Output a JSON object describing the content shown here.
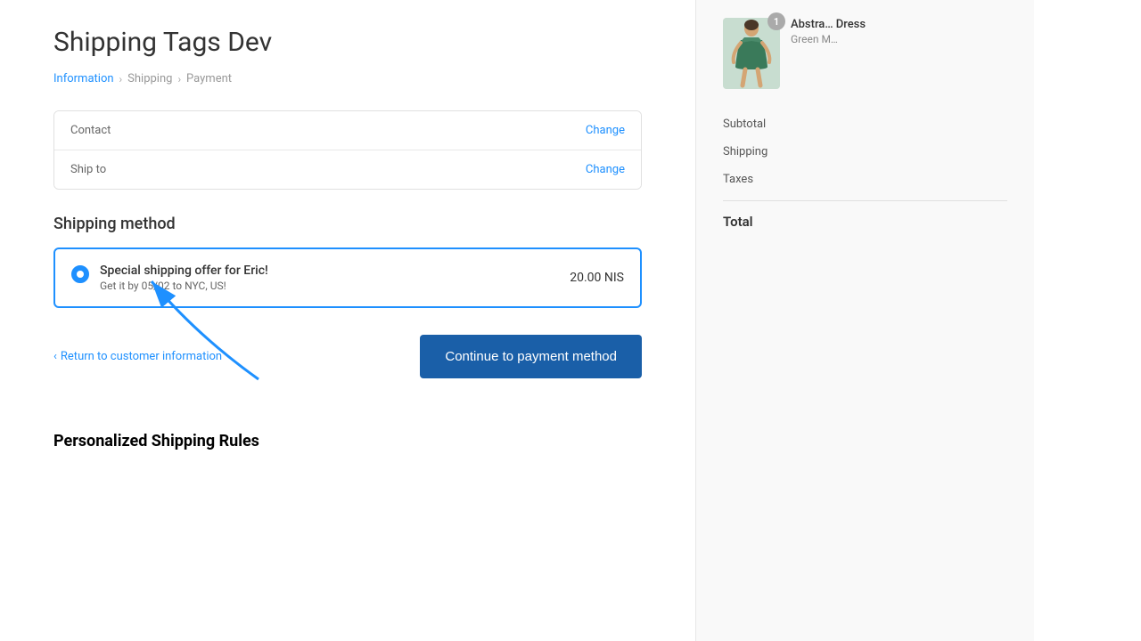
{
  "page": {
    "title": "Shipping Tags Dev"
  },
  "breadcrumb": {
    "information_label": "Information",
    "shipping_label": "Shipping",
    "payment_label": "Payment"
  },
  "info_card": {
    "contact_label": "Contact",
    "contact_change": "Change",
    "ship_to_label": "Ship to",
    "ship_to_change": "Change"
  },
  "shipping": {
    "section_title": "Shipping method",
    "option_name": "Special shipping offer for Eric!",
    "option_date": "Get it by 05/02 to NYC, US!",
    "option_price": "20.00 NIS"
  },
  "actions": {
    "return_link": "Return to customer information",
    "continue_button": "Continue to payment method"
  },
  "annotation": {
    "label": "Personalized Shipping Rules"
  },
  "sidebar": {
    "product_name": "Abstra… Dress",
    "product_variant": "Green M…",
    "subtotal_label": "Subtotal",
    "shipping_label": "Shipping",
    "taxes_label": "Taxes",
    "total_label": "Total"
  }
}
